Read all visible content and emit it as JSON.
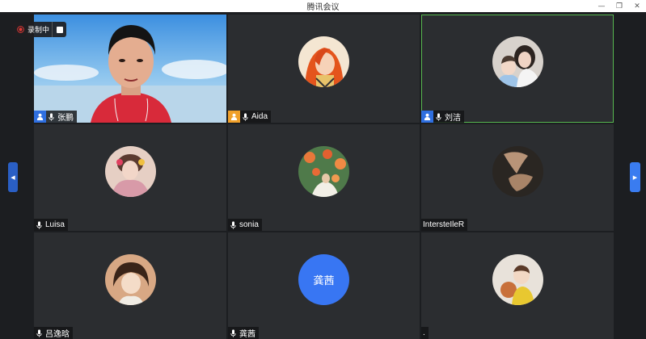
{
  "window": {
    "title": "腾讯会议",
    "minimize_glyph": "—",
    "restore_glyph": "❐",
    "close_glyph": "✕"
  },
  "recording": {
    "label": "录制中",
    "icon": "record-dot-icon",
    "color": "#e53935"
  },
  "navigation": {
    "prev_icon": "chevron-left-icon",
    "next_icon": "chevron-right-icon",
    "prev_glyph": "◀",
    "next_glyph": "▶",
    "accent": "#2f6fe0"
  },
  "participants": [
    {
      "name": "张鹏",
      "role": "cohost",
      "mic": true,
      "video": true
    },
    {
      "name": "Aida",
      "role": "host",
      "mic": true,
      "video": false
    },
    {
      "name": "刘洁",
      "role": "cohost",
      "mic": true,
      "video": false,
      "speaking": true
    },
    {
      "name": "Luisa",
      "role": "none",
      "mic": true,
      "video": false
    },
    {
      "name": "sonia",
      "role": "none",
      "mic": true,
      "video": false
    },
    {
      "name": "IntersteIleR",
      "role": "none",
      "mic": false,
      "video": false
    },
    {
      "name": "吕逸晗",
      "role": "none",
      "mic": true,
      "video": false
    },
    {
      "name": "龚茜",
      "role": "none",
      "mic": true,
      "video": false,
      "avatar_text": "龚茜"
    },
    {
      "name": ".",
      "role": "none",
      "mic": false,
      "video": false
    }
  ],
  "colors": {
    "tile_bg": "#2b2d30",
    "active_border": "#58b850",
    "host_badge": "#f0a02a",
    "cohost_badge": "#2f6fe0",
    "text_avatar": "#3876f3"
  }
}
